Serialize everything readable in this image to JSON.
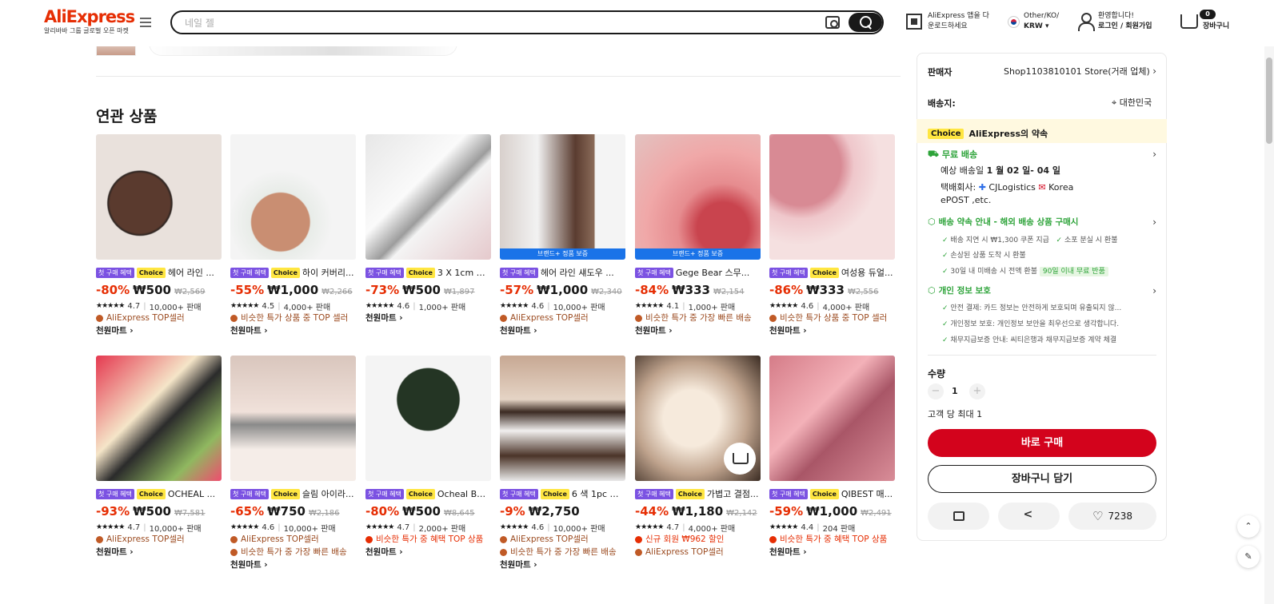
{
  "header": {
    "logo": "AliExpress",
    "logo_sub": "알리바바 그룹 글로벌 오픈 마켓",
    "search_placeholder": "네일 젤",
    "app_line1": "AliExpress 앱을 다",
    "app_line2": "운로드하세요",
    "region_line1": "Other/KO/",
    "region_line2": "KRW ▾",
    "welcome": "환영합니다!",
    "login": "로그인 / 회원가입",
    "cart_label": "장바구니",
    "cart_count": "0"
  },
  "section_title": "연관 상품",
  "tags": {
    "first": "첫 구매 혜택",
    "choice": "Choice",
    "brand": "브랜드+ 정품 보증"
  },
  "products": [
    {
      "title": "헤어 라인 ...",
      "choice": true,
      "first": true,
      "disc": "-80%",
      "price": "₩500",
      "orig": "₩2,569",
      "stars": "★★★★★",
      "rating": "4.7",
      "sold": "10,000+ 판매",
      "badges": [
        {
          "text": "AliExpress TOP셀러",
          "color": "brown"
        }
      ],
      "store": "천원마트 ›",
      "img": "hair",
      "brand": false
    },
    {
      "title": "하이 커버리...",
      "choice": true,
      "first": true,
      "disc": "-55%",
      "price": "₩1,000",
      "orig": "₩2,266",
      "stars": "★★★★★",
      "rating": "4.5",
      "sold": "4,000+ 판매",
      "badges": [
        {
          "text": "비슷한 특가 상품 중 TOP 셀러",
          "color": "brown"
        }
      ],
      "store": "천원마트 ›",
      "img": "concealer",
      "brand": false
    },
    {
      "title": "3 X 1cm 라...",
      "choice": true,
      "first": true,
      "disc": "-73%",
      "price": "₩500",
      "orig": "₩1,897",
      "stars": "★★★★★",
      "rating": "4.6",
      "sold": "1,000+ 판매",
      "badges": [],
      "store": "천원마트 ›",
      "img": "magnet",
      "brand": false
    },
    {
      "title": "헤어 라인 섀도우 ...",
      "choice": false,
      "first": true,
      "disc": "-57%",
      "price": "₩1,000",
      "orig": "₩2,340",
      "stars": "★★★★★",
      "rating": "4.6",
      "sold": "10,000+ 판매",
      "badges": [
        {
          "text": "AliExpress TOP셀러",
          "color": "brown"
        }
      ],
      "store": "천원마트 ›",
      "img": "hairstick",
      "brand": true
    },
    {
      "title": "Gege Bear 스무...",
      "choice": false,
      "first": true,
      "disc": "-84%",
      "price": "₩333",
      "orig": "₩2,154",
      "stars": "★★★★★",
      "rating": "4.1",
      "sold": "1,000+ 판매",
      "badges": [
        {
          "text": "비슷한 특가 중 가장 빠른 배송",
          "color": "brown"
        }
      ],
      "store": "천원마트 ›",
      "img": "lip",
      "brand": true
    },
    {
      "title": "여성용 듀얼...",
      "choice": true,
      "first": true,
      "disc": "-86%",
      "price": "₩333",
      "orig": "₩2,556",
      "stars": "★★★★★",
      "rating": "4.6",
      "sold": "4,000+ 판매",
      "badges": [
        {
          "text": "비슷한 특가 상품 중 TOP 셀러",
          "color": "brown"
        }
      ],
      "store": "천원마트 ›",
      "img": "blush",
      "brand": false
    },
    {
      "title": "OCHEAL ...",
      "choice": true,
      "first": true,
      "disc": "-93%",
      "price": "₩500",
      "orig": "₩7,581",
      "stars": "★★★★★",
      "rating": "4.7",
      "sold": "10,000+ 판매",
      "badges": [
        {
          "text": "AliExpress TOP셀러",
          "color": "brown"
        }
      ],
      "store": "천원마트 ›",
      "img": "cushion",
      "brand": false
    },
    {
      "title": "슬림 아이라...",
      "choice": true,
      "first": true,
      "disc": "-65%",
      "price": "₩750",
      "orig": "₩2,186",
      "stars": "★★★★★",
      "rating": "4.6",
      "sold": "10,000+ 판매",
      "badges": [
        {
          "text": "AliExpress TOP셀러",
          "color": "brown"
        },
        {
          "text": "비슷한 특가 중 가장 빠른 배송",
          "color": "brown"
        }
      ],
      "store": "천원마트 ›",
      "img": "eyeliner",
      "brand": false
    },
    {
      "title": "Ocheal BB...",
      "choice": true,
      "first": true,
      "disc": "-80%",
      "price": "₩500",
      "orig": "₩8,645",
      "stars": "★★★★★",
      "rating": "4.7",
      "sold": "2,000+ 판매",
      "badges": [
        {
          "text": "비슷한 특가 중 혜택 TOP 상품",
          "color": "red"
        }
      ],
      "store": "천원마트 ›",
      "img": "bb",
      "brand": false
    },
    {
      "title": "6 색 1pc 눈...",
      "choice": true,
      "first": true,
      "disc": "-9%",
      "price": "₩2,750",
      "orig": "",
      "stars": "★★★★★",
      "rating": "4.6",
      "sold": "10,000+ 판매",
      "badges": [
        {
          "text": "AliExpress TOP셀러",
          "color": "brown"
        },
        {
          "text": "비슷한 특가 중 가장 빠른 배송",
          "color": "brown"
        }
      ],
      "store": "천원마트 ›",
      "img": "brow",
      "brand": false
    },
    {
      "title": "가볍고 결점...",
      "choice": true,
      "first": true,
      "disc": "-44%",
      "price": "₩1,180",
      "orig": "₩2,142",
      "stars": "★★★★★",
      "rating": "4.7",
      "sold": "4,000+ 판매",
      "badges": [
        {
          "text": "신규 회원 ₩962 할인",
          "color": "red"
        },
        {
          "text": "AliExpress TOP셀러",
          "color": "brown"
        }
      ],
      "store": "",
      "img": "powder",
      "brand": false
    },
    {
      "title": "QIBEST 매...",
      "choice": true,
      "first": true,
      "disc": "-59%",
      "price": "₩1,000",
      "orig": "₩2,491",
      "stars": "★★★★★",
      "rating": "4.4",
      "sold": "204 판매",
      "badges": [
        {
          "text": "비슷한 특가 중 혜택 TOP 상품",
          "color": "red"
        }
      ],
      "store": "천원마트 ›",
      "img": "lips2",
      "brand": false
    }
  ],
  "panel": {
    "seller_label": "판매자",
    "seller_value": "Shop1103810101 Store(거래 업체)",
    "ship_label": "배송지:",
    "ship_value": "대한민국",
    "promise_chip": "Choice",
    "promise_text": "AliExpress의 약속",
    "free_ship": "무료 배송",
    "eta_prefix": "예상 배송일",
    "eta_dates": "1 월 02 일- 04 일",
    "carrier_label": "택배회사:",
    "carrier_1": "CJLogistics",
    "carrier_2": "Korea",
    "carrier_3": "ePOST ,etc.",
    "guarantee_title": "배송 약속 안내 - 해외 배송 상품 구매시",
    "g1": "배송 지연 시 ₩1,300 쿠폰 지급",
    "g2": "소포 분실 시 환불",
    "g3": "손상된 상품 도착 시 환불",
    "g4": "30일 내 미배송 시 전액 환불",
    "g4_pill": "90일 이내 무료 반품",
    "privacy_title": "개인 정보 보호",
    "p1": "안전 결제: 카드 정보는 안전하게 보호되며 유출되지 않...",
    "p2": "개인정보 보호: 개인정보 보안을 최우선으로 생각합니다.",
    "p3": "채무지급보증 안내: 씨티은행과 채무지급보증 계약 체결",
    "qty_label": "수량",
    "qty_value": "1",
    "max_note": "고객 당 최대 1",
    "buy_now": "바로 구매",
    "add_cart": "장바구니 담기",
    "wishlist_count": "7238"
  }
}
